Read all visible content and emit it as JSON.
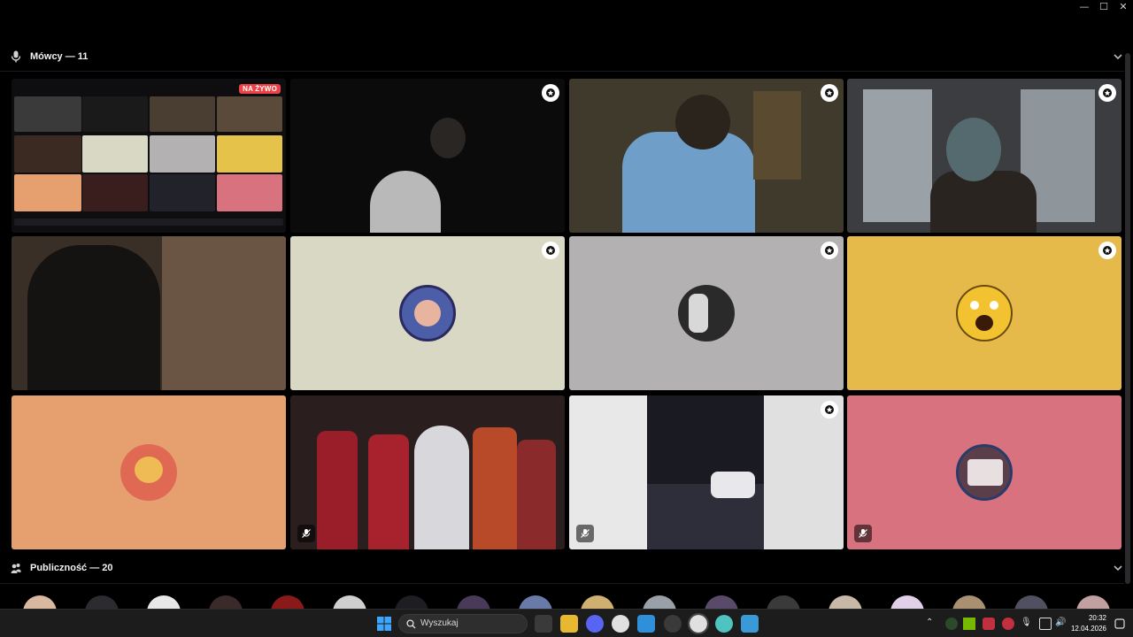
{
  "window": {
    "minimize_glyph": "—",
    "maximize_glyph": "☐",
    "close_glyph": "✕"
  },
  "speakers": {
    "title": "Mówcy — 11",
    "icon": "microphone-icon"
  },
  "audience": {
    "title": "Publiczność — 20",
    "icon": "audience-icon"
  },
  "stream": {
    "live_badge": "NA ŻYWO"
  },
  "tiles": [
    {
      "kind": "stream",
      "bg": "#0e0e10"
    },
    {
      "kind": "video",
      "bg": "#0b0b0c",
      "pinned": true
    },
    {
      "kind": "video",
      "bg": "#3f3a2c",
      "pinned": true
    },
    {
      "kind": "video",
      "bg": "#3b3d40",
      "pinned": true
    },
    {
      "kind": "video",
      "bg": "#3a2f26",
      "pinned": false
    },
    {
      "kind": "avatar",
      "bg": "#d9d8c4",
      "avatar_bg": "#4d5ea8",
      "pinned": true
    },
    {
      "kind": "avatar",
      "bg": "#b3b1b2",
      "avatar_bg": "#2a2a2a",
      "pinned": true
    },
    {
      "kind": "avatar",
      "bg": "#e5b94a",
      "avatar_bg": "#f2c230",
      "pinned": true
    },
    {
      "kind": "avatar",
      "bg": "#e6a070",
      "avatar_bg": "#e06050",
      "pinned": false
    },
    {
      "kind": "video",
      "bg": "#2a1e1e",
      "muted": true
    },
    {
      "kind": "video",
      "bg": "#1a1a22",
      "pinned": true,
      "muted": true
    },
    {
      "kind": "avatar",
      "bg": "#d9727f",
      "avatar_bg": "#5a3f4a",
      "muted": true
    }
  ],
  "audience_avatars": [
    "#d9b8a0",
    "#2b2b30",
    "#e8e8e8",
    "#3a2a2a",
    "#8a1a1a",
    "#cfcfcf",
    "#1e1e22",
    "#4a3a5a",
    "#6a7aa8",
    "#d0b070",
    "#9aa0a8",
    "#5a4a6a",
    "#3a3a3a",
    "#c8b8a8",
    "#e0d0e8",
    "#a89070",
    "#505060",
    "#c0a0a0"
  ],
  "taskbar": {
    "search_placeholder": "Wyszukaj",
    "time": "20:32",
    "date": "12.04.2026"
  },
  "colors": {
    "accent_live": "#ed4245",
    "taskbar": "#1c1c1c"
  }
}
